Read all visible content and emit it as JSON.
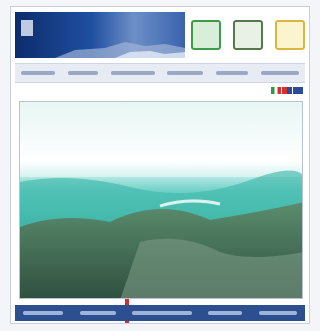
{
  "colors": {
    "banner_dark": "#0d2c6b",
    "nav_background": "#e6ebf4",
    "footer_background": "#2c4f8f",
    "accent_red": "#d0302c"
  },
  "header": {
    "icons": [
      "green-leaf-icon",
      "tree-icon",
      "yellow-sun-icon"
    ]
  },
  "nav": {
    "item_count": 6
  },
  "flags": [
    "italy-flag-icon",
    "uk-flag-icon",
    "blue-flag-icon"
  ],
  "footer": {
    "item_count": 5
  }
}
